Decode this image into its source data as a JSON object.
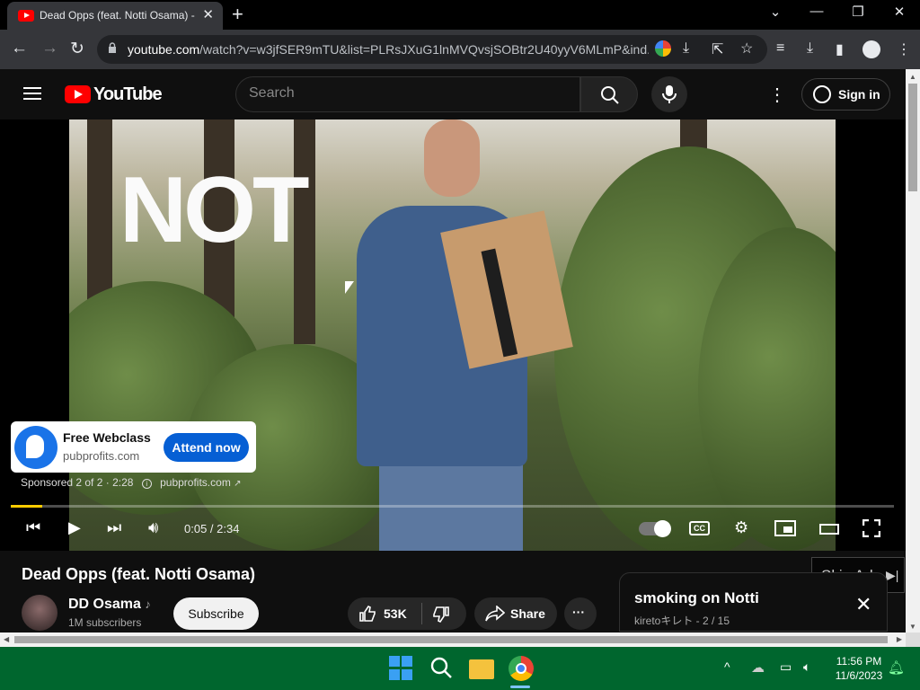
{
  "browser": {
    "tab_title": "Dead Opps (feat. Notti Osama) -",
    "tab_close": "✕",
    "new_tab": "+",
    "url_host": "youtube.com",
    "url_rest": "/watch?v=w3jfSER9mTU&list=PLRsJXuG1lnMVQvsjSOBtr2U40yyV6MLmP&ind..."
  },
  "youtube": {
    "logo_text": "YouTube",
    "search_placeholder": "Search",
    "signin_label": "Sign in",
    "more_menu": "⋮"
  },
  "video": {
    "overlay_text": "NOT",
    "time_display": "0:05 / 2:34",
    "progress_fraction": 0.036,
    "cc_label": "CC"
  },
  "ad": {
    "title": "Free Webclass",
    "domain": "pubprofits.com",
    "cta": "Attend now",
    "sponsored_text": "Sponsored 2 of 2 · 2:28",
    "sponsored_link": "pubprofits.com",
    "skip_label": "Skip Ad",
    "skip_icon": "▶|"
  },
  "below": {
    "title": "Dead Opps (feat. Notti Osama)",
    "channel_name": "DD Osama",
    "music_note": "♪",
    "subscribers": "1M subscribers",
    "subscribe_label": "Subscribe",
    "like_count": "53K",
    "share_label": "Share",
    "more_label": "···"
  },
  "playlist": {
    "title": "smoking on Notti",
    "meta": "kiretoキレト - 2 / 15",
    "close": "✕"
  },
  "taskbar": {
    "time": "11:56 PM",
    "date": "11/6/2023"
  },
  "colors": {
    "brand_red": "#ff0000",
    "ad_blue": "#065fd4",
    "progress_yellow": "#ffcc00",
    "taskbar_green": "#00662e"
  }
}
